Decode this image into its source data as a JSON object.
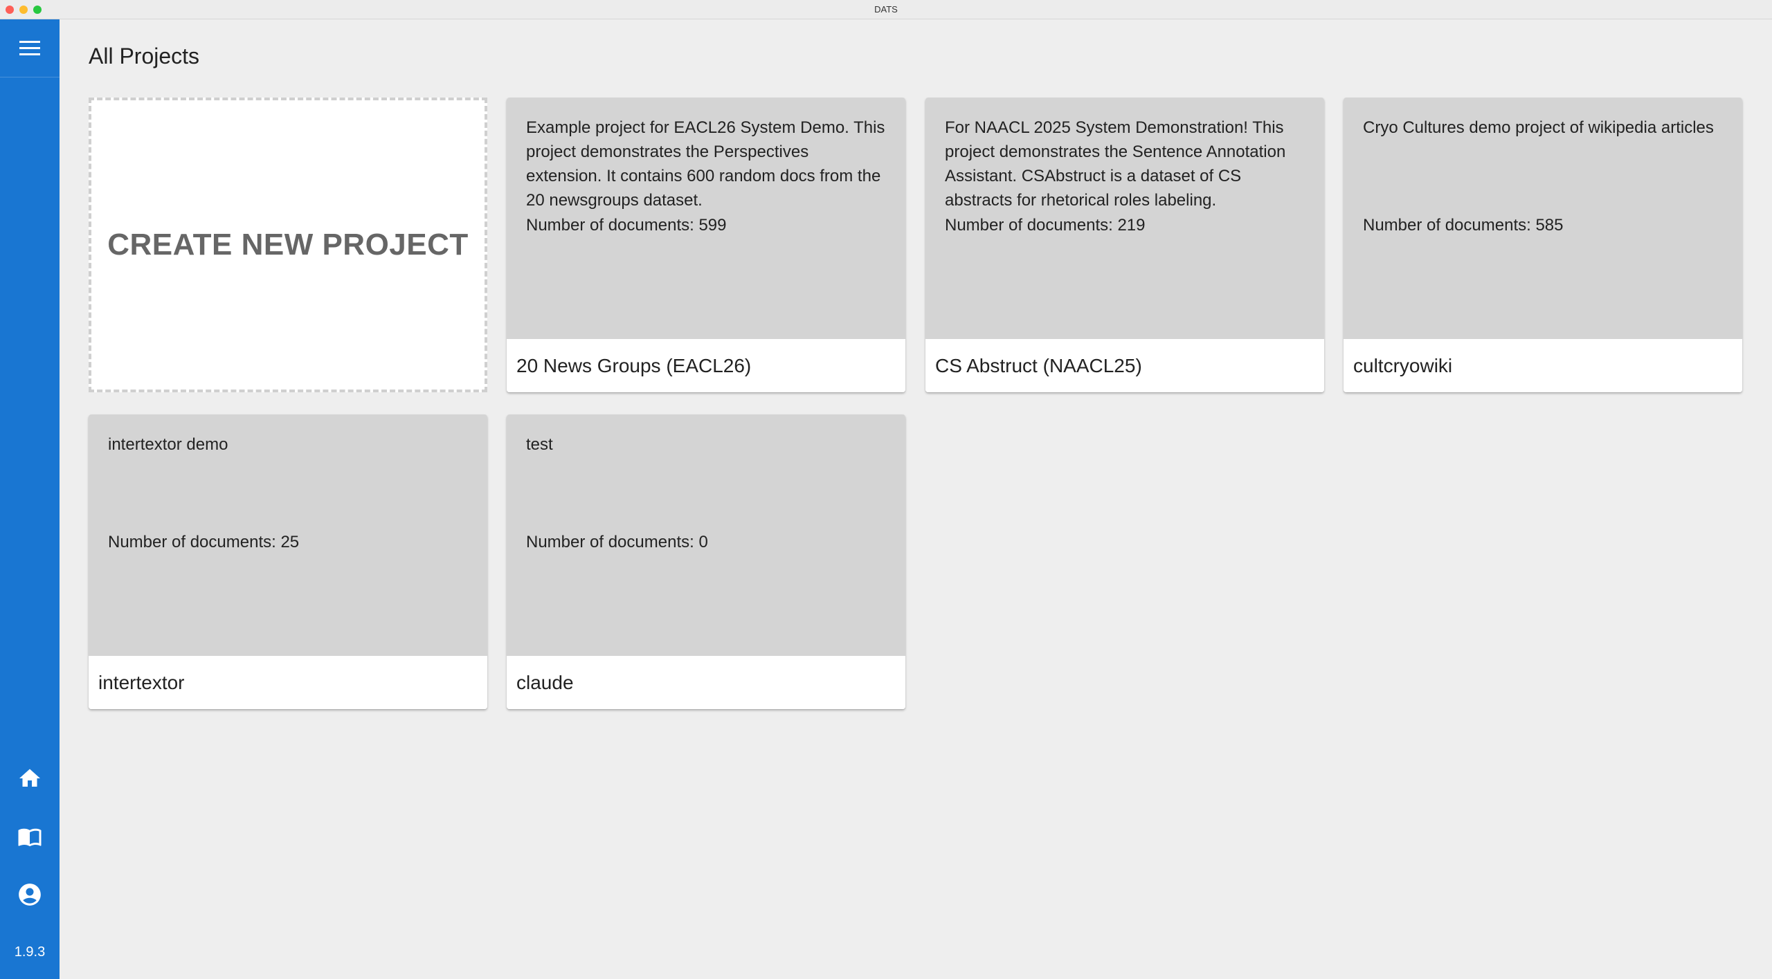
{
  "window": {
    "title": "DATS"
  },
  "sidebar": {
    "icons": [
      "menu-icon",
      "home-icon",
      "book-icon",
      "account-icon"
    ],
    "version": "1.9.3",
    "color": "#1976d2"
  },
  "page": {
    "title": "All Projects"
  },
  "create": {
    "label": "CREATE NEW PROJECT"
  },
  "projects": [
    {
      "name": "20 News Groups (EACL26)",
      "description": "Example project for EACL26 System Demo. This project demonstrates the Perspectives extension. It contains 600 random docs from the 20 newsgroups dataset.",
      "doc_count": "Number of documents: 599"
    },
    {
      "name": "CS Abstruct (NAACL25)",
      "description": "For NAACL 2025 System Demonstration! This project demonstrates the Sentence Annotation Assistant. CSAbstruct is a dataset of CS abstracts for rhetorical roles labeling.",
      "doc_count": "Number of documents: 219"
    },
    {
      "name": "cultcryowiki",
      "description": "Cryo Cultures demo project of wikipedia articles",
      "doc_count": "Number of documents: 585"
    },
    {
      "name": "intertextor",
      "description": "intertextor demo",
      "doc_count": "Number of documents: 25"
    },
    {
      "name": "claude",
      "description": "test",
      "doc_count": "Number of documents: 0"
    }
  ]
}
